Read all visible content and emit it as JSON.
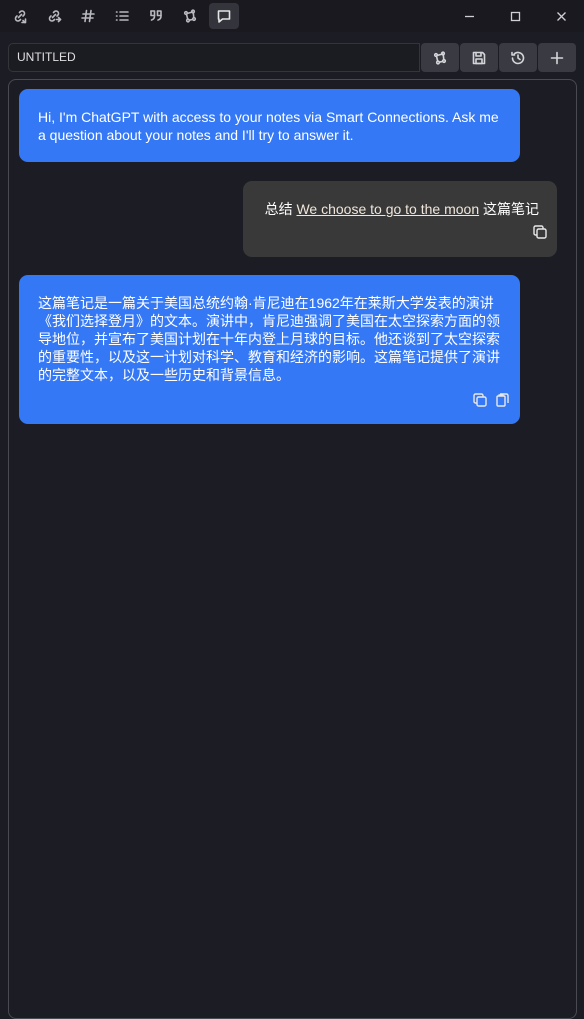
{
  "toolbar": {
    "icons": [
      {
        "name": "backlinks-icon"
      },
      {
        "name": "outgoing-links-icon"
      },
      {
        "name": "tags-icon"
      },
      {
        "name": "outline-icon"
      },
      {
        "name": "quote-icon"
      },
      {
        "name": "smart-connections-icon"
      },
      {
        "name": "chat-icon",
        "active": true
      }
    ]
  },
  "window": {
    "minimize": "minimize",
    "maximize": "maximize",
    "close": "close"
  },
  "chat_header": {
    "title_value": "UNTITLED"
  },
  "messages": [
    {
      "role": "assistant",
      "text": "Hi, I'm ChatGPT with access to your notes via Smart Connections. Ask me a question about your notes and I'll try to answer it."
    },
    {
      "role": "user",
      "prefix": "总结 ",
      "link": "We choose to go to the moon",
      "suffix": " 这篇笔记"
    },
    {
      "role": "assistant",
      "text": "这篇笔记是一篇关于美国总统约翰·肯尼迪在1962年在莱斯大学发表的演讲《我们选择登月》的文本。演讲中，肯尼迪强调了美国在太空探索方面的领导地位，并宣布了美国计划在十年内登上月球的目标。他还谈到了太空探索的重要性，以及这一计划对科学、教育和经济的影响。这篇笔记提供了演讲的完整文本，以及一些历史和背景信息。"
    }
  ],
  "colors": {
    "assistant_bubble": "#3478f6",
    "user_bubble": "#393939",
    "background": "#1c1c24"
  }
}
